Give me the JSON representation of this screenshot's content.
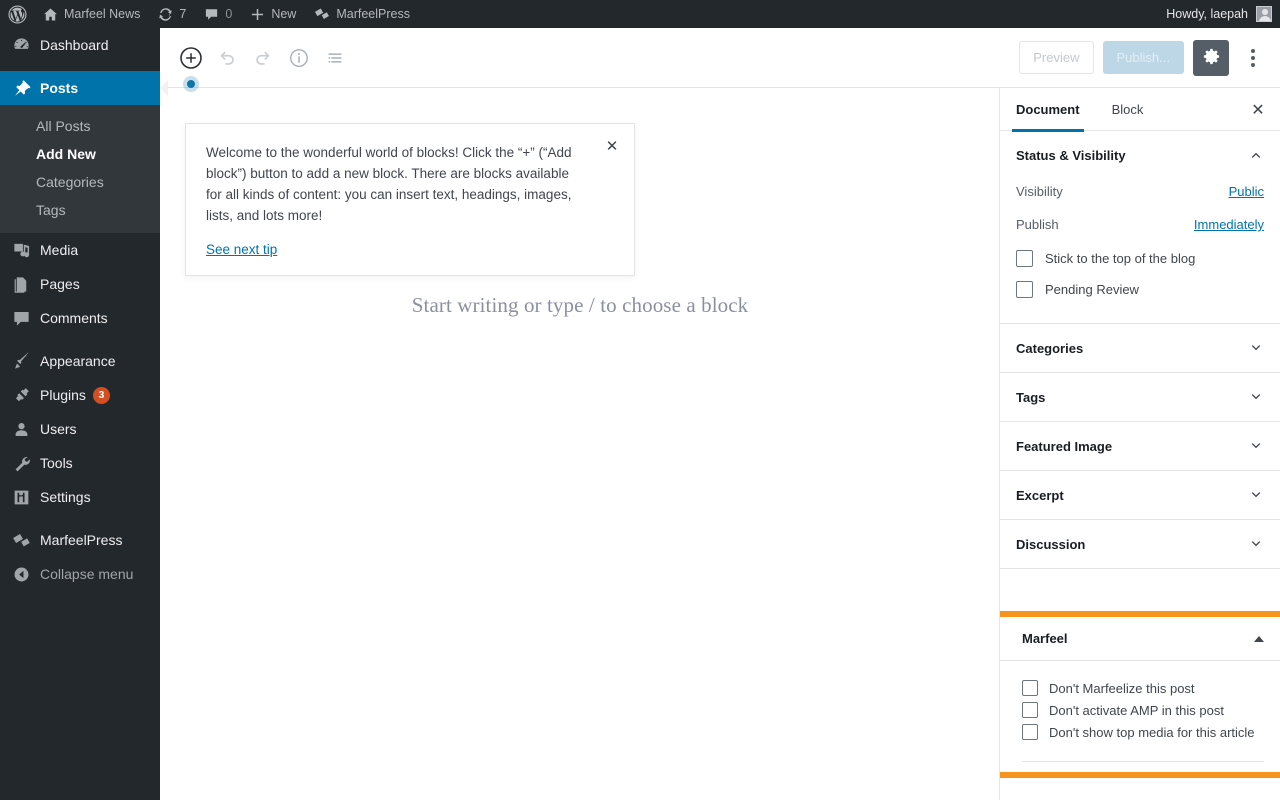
{
  "adminbar": {
    "wp_logo_icon": "wordpress-logo-icon",
    "site_icon": "home-icon",
    "site_name": "Marfeel News",
    "updates_icon": "updates-icon",
    "updates_count": "7",
    "comments_icon": "comment-bubble-icon",
    "comments_count": "0",
    "new_icon": "plus-icon",
    "new_label": "New",
    "marfeelpress_icon": "marfeel-flag-icon",
    "marfeelpress_label": "MarfeelPress",
    "howdy": "Howdy, laepah",
    "avatar_icon": "avatar-icon"
  },
  "adminmenu": {
    "items": [
      {
        "label": "Dashboard",
        "icon": "dashboard-icon"
      },
      {
        "label": "Posts",
        "icon": "pin-icon",
        "current": true
      },
      {
        "label": "Media",
        "icon": "media-icon"
      },
      {
        "label": "Pages",
        "icon": "pages-icon"
      },
      {
        "label": "Comments",
        "icon": "comment-bubble-icon"
      },
      {
        "label": "Appearance",
        "icon": "paintbrush-icon"
      },
      {
        "label": "Plugins",
        "icon": "plug-icon",
        "badge": "3"
      },
      {
        "label": "Users",
        "icon": "user-icon"
      },
      {
        "label": "Tools",
        "icon": "wrench-icon"
      },
      {
        "label": "Settings",
        "icon": "sliders-icon"
      },
      {
        "label": "MarfeelPress",
        "icon": "marfeel-flag-icon"
      },
      {
        "label": "Collapse menu",
        "icon": "collapse-arrow-icon"
      }
    ],
    "posts_submenu": [
      {
        "label": "All Posts"
      },
      {
        "label": "Add New",
        "current": true
      },
      {
        "label": "Categories"
      },
      {
        "label": "Tags"
      }
    ]
  },
  "header": {
    "inserter_icon": "add-block-plus-icon",
    "undo_icon": "undo-icon",
    "redo_icon": "redo-icon",
    "info_icon": "content-info-icon",
    "outline_icon": "block-navigation-icon",
    "preview_label": "Preview",
    "publish_label": "Publish...",
    "settings_gear_icon": "gear-icon",
    "more_menu_icon": "more-vertical-icon"
  },
  "tip": {
    "body": "Welcome to the wonderful world of blocks! Click the “+” (“Add block”) button to add a new block. There are blocks available for all kinds of content: you can insert text, headings, images, lists, and lots more!",
    "next_label": "See next tip",
    "close_icon": "close-icon"
  },
  "editor": {
    "block_placeholder": "Start writing or type / to choose a block"
  },
  "settings": {
    "tabs": [
      {
        "label": "Document",
        "active": true
      },
      {
        "label": "Block",
        "active": false
      }
    ],
    "close_icon": "close-icon",
    "status": {
      "title": "Status & Visibility",
      "chevron_icon": "chevron-up-icon",
      "visibility_label": "Visibility",
      "visibility_value": "Public",
      "publish_label": "Publish",
      "publish_value": "Immediately",
      "sticky_label": "Stick to the top of the blog",
      "pending_label": "Pending Review"
    },
    "panels": [
      {
        "title": "Categories",
        "chevron_icon": "chevron-down-icon"
      },
      {
        "title": "Tags",
        "chevron_icon": "chevron-down-icon"
      },
      {
        "title": "Featured Image",
        "chevron_icon": "chevron-down-icon"
      },
      {
        "title": "Excerpt",
        "chevron_icon": "chevron-down-icon"
      },
      {
        "title": "Discussion",
        "chevron_icon": "chevron-down-icon"
      }
    ],
    "marfeel": {
      "title": "Marfeel",
      "chevron_icon": "caret-up-icon",
      "highlight_color": "#f7941e",
      "options": [
        {
          "label": "Don't Marfeelize this post"
        },
        {
          "label": "Don't activate AMP in this post"
        },
        {
          "label": "Don't show top media for this article"
        }
      ]
    }
  },
  "colors": {
    "admin_dark": "#23282d",
    "admin_submenu": "#32373c",
    "current_blue": "#0073aa",
    "link_blue": "#0073aa",
    "badge_orange": "#d54e21",
    "highlight_orange": "#f7941e"
  }
}
